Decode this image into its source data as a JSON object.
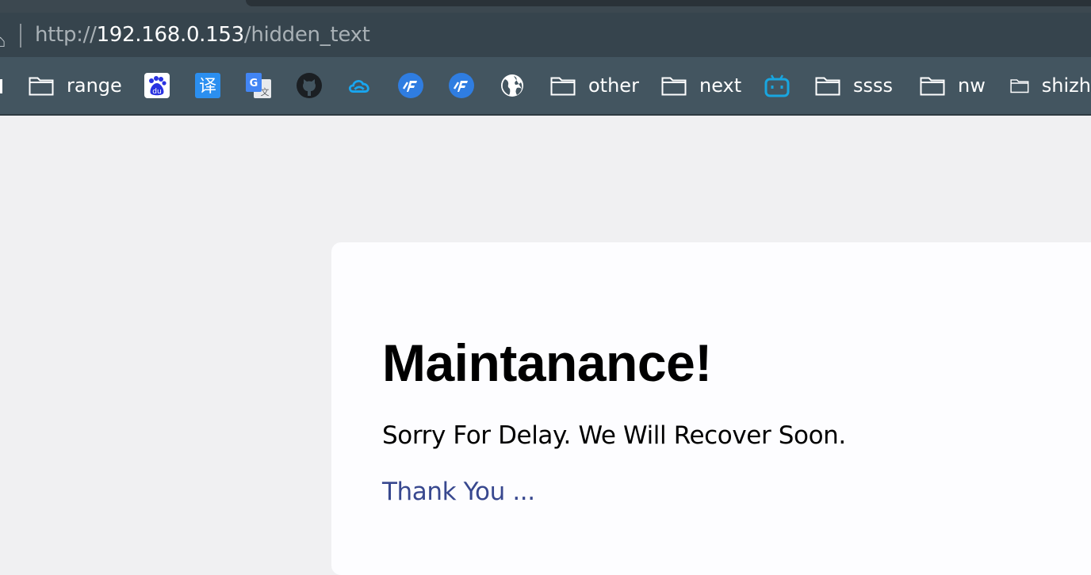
{
  "browser": {
    "address": {
      "scheme": "http://",
      "host": "192.168.0.153",
      "path": "/hidden_text"
    },
    "bookmarks": [
      {
        "type": "folder",
        "label": "range",
        "icon": "folder-icon"
      },
      {
        "type": "site",
        "label": "",
        "icon": "baidu-icon"
      },
      {
        "type": "site",
        "label": "",
        "icon": "translate-icon"
      },
      {
        "type": "site",
        "label": "",
        "icon": "google-translate-icon"
      },
      {
        "type": "site",
        "label": "",
        "icon": "github-icon"
      },
      {
        "type": "site",
        "label": "",
        "icon": "cloud-icon"
      },
      {
        "type": "site",
        "label": "",
        "icon": "f-logo-icon"
      },
      {
        "type": "site",
        "label": "",
        "icon": "f-logo-icon"
      },
      {
        "type": "site",
        "label": "",
        "icon": "globe-icon"
      },
      {
        "type": "folder",
        "label": "other",
        "icon": "folder-icon"
      },
      {
        "type": "folder",
        "label": "next",
        "icon": "folder-icon"
      },
      {
        "type": "site",
        "label": "",
        "icon": "bilibili-icon"
      },
      {
        "type": "folder",
        "label": "ssss",
        "icon": "folder-icon"
      },
      {
        "type": "folder",
        "label": "nw",
        "icon": "folder-icon"
      },
      {
        "type": "folder",
        "label": "shizh",
        "icon": "folder-icon"
      }
    ]
  },
  "page": {
    "title": "Maintanance!",
    "message": "Sorry For Delay. We Will Recover Soon.",
    "thanks": "Thank You ..."
  },
  "colors": {
    "chrome_dark": "#36444d",
    "bookmarks_bar": "#435560",
    "page_bg": "#f0f0f2",
    "card_bg": "#fdfdff",
    "link": "#38488f",
    "icon_blue": "#2f7de1"
  }
}
